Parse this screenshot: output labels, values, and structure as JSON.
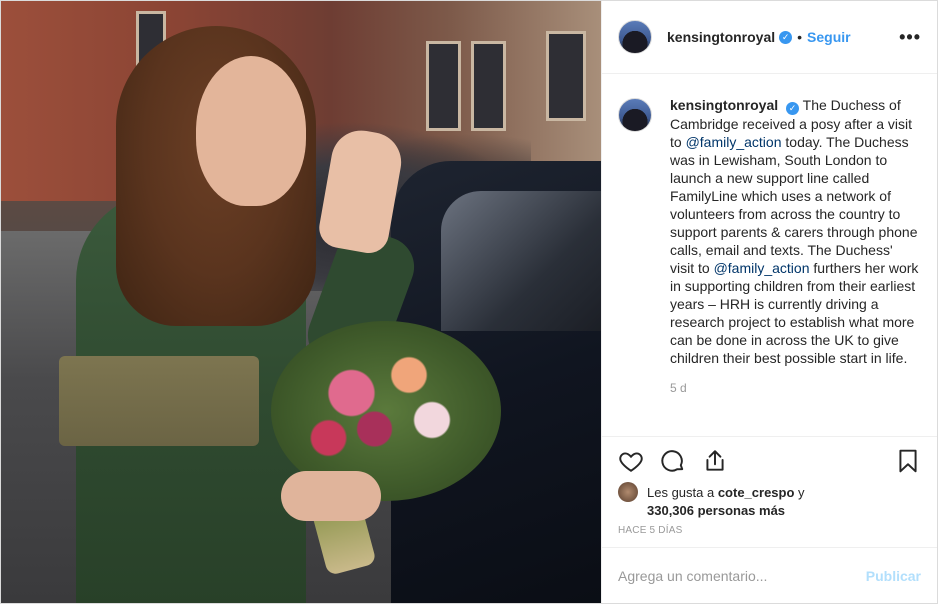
{
  "post": {
    "photo_alt": "Post photo",
    "header": {
      "username": "kensingtonroyal",
      "verified_icon": "verified-badge-icon",
      "separator": "•",
      "follow_label": "Seguir",
      "more_label": "•••"
    },
    "caption": {
      "username": "kensingtonroyal",
      "text_1": "The Duchess of Cambridge received a posy after a visit to ",
      "mention_1": "@family_action",
      "text_2": " today. The Duchess was in Lewisham, South London to launch a new support line called FamilyLine which uses a network of volunteers from across the country to support parents & carers through phone calls, email and texts. The Duchess' visit to ",
      "mention_2": "@family_action",
      "text_3": " furthers her work in supporting children from their earliest years – HRH is currently driving a research project to establish what more can be done in across the UK to give children their best possible start in life.",
      "age": "5 d"
    },
    "actions": {
      "like_icon": "heart-icon",
      "comment_icon": "comment-icon",
      "share_icon": "share-icon",
      "save_icon": "bookmark-icon"
    },
    "likes": {
      "prefix": "Les gusta a ",
      "user": "cote_crespo",
      "conjunction": " y",
      "count": "330,306 personas más"
    },
    "posted_ago": "HACE 5 DÍAS",
    "add_comment": {
      "placeholder": "Agrega un comentario...",
      "publish_label": "Publicar"
    }
  },
  "colors": {
    "accent": "#3897f0",
    "mention": "#003569",
    "publish_disabled": "#b2dffc",
    "muted": "#999999"
  }
}
